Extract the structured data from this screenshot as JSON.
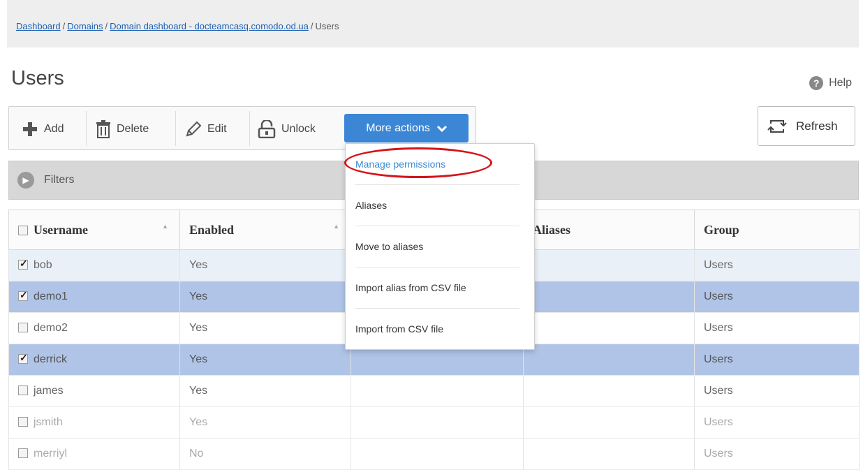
{
  "breadcrumb": {
    "items": [
      "Dashboard",
      "Domains",
      "Domain dashboard - docteamcasq.comodo.od.ua"
    ],
    "current": "Users",
    "sep": "/"
  },
  "page_title": "Users",
  "help_label": "Help",
  "toolbar": {
    "add": "Add",
    "delete": "Delete",
    "edit": "Edit",
    "unlock": "Unlock",
    "more_actions": "More actions"
  },
  "refresh_label": "Refresh",
  "filters_label": "Filters",
  "table": {
    "headers": [
      "Username",
      "Enabled",
      "",
      "Aliases",
      "Group"
    ],
    "rows": [
      {
        "username": "bob",
        "enabled": "Yes",
        "group": "Users",
        "checked": true
      },
      {
        "username": "demo1",
        "enabled": "Yes",
        "group": "Users",
        "checked": true
      },
      {
        "username": "demo2",
        "enabled": "Yes",
        "group": "Users",
        "checked": false
      },
      {
        "username": "derrick",
        "enabled": "Yes",
        "group": "Users",
        "checked": true
      },
      {
        "username": "james",
        "enabled": "Yes",
        "group": "Users",
        "checked": false
      },
      {
        "username": "jsmith",
        "enabled": "Yes",
        "group": "Users",
        "checked": false
      },
      {
        "username": "merriyl",
        "enabled": "No",
        "group": "Users",
        "checked": false
      }
    ]
  },
  "dropdown": {
    "items": [
      "Manage permissions",
      "Aliases",
      "Move to aliases",
      "Import alias from CSV file",
      "Import from CSV file"
    ]
  },
  "colors": {
    "accent": "#3b87d6",
    "selected_row": "#b0c4e8",
    "highlight_ring": "#d4151a"
  }
}
